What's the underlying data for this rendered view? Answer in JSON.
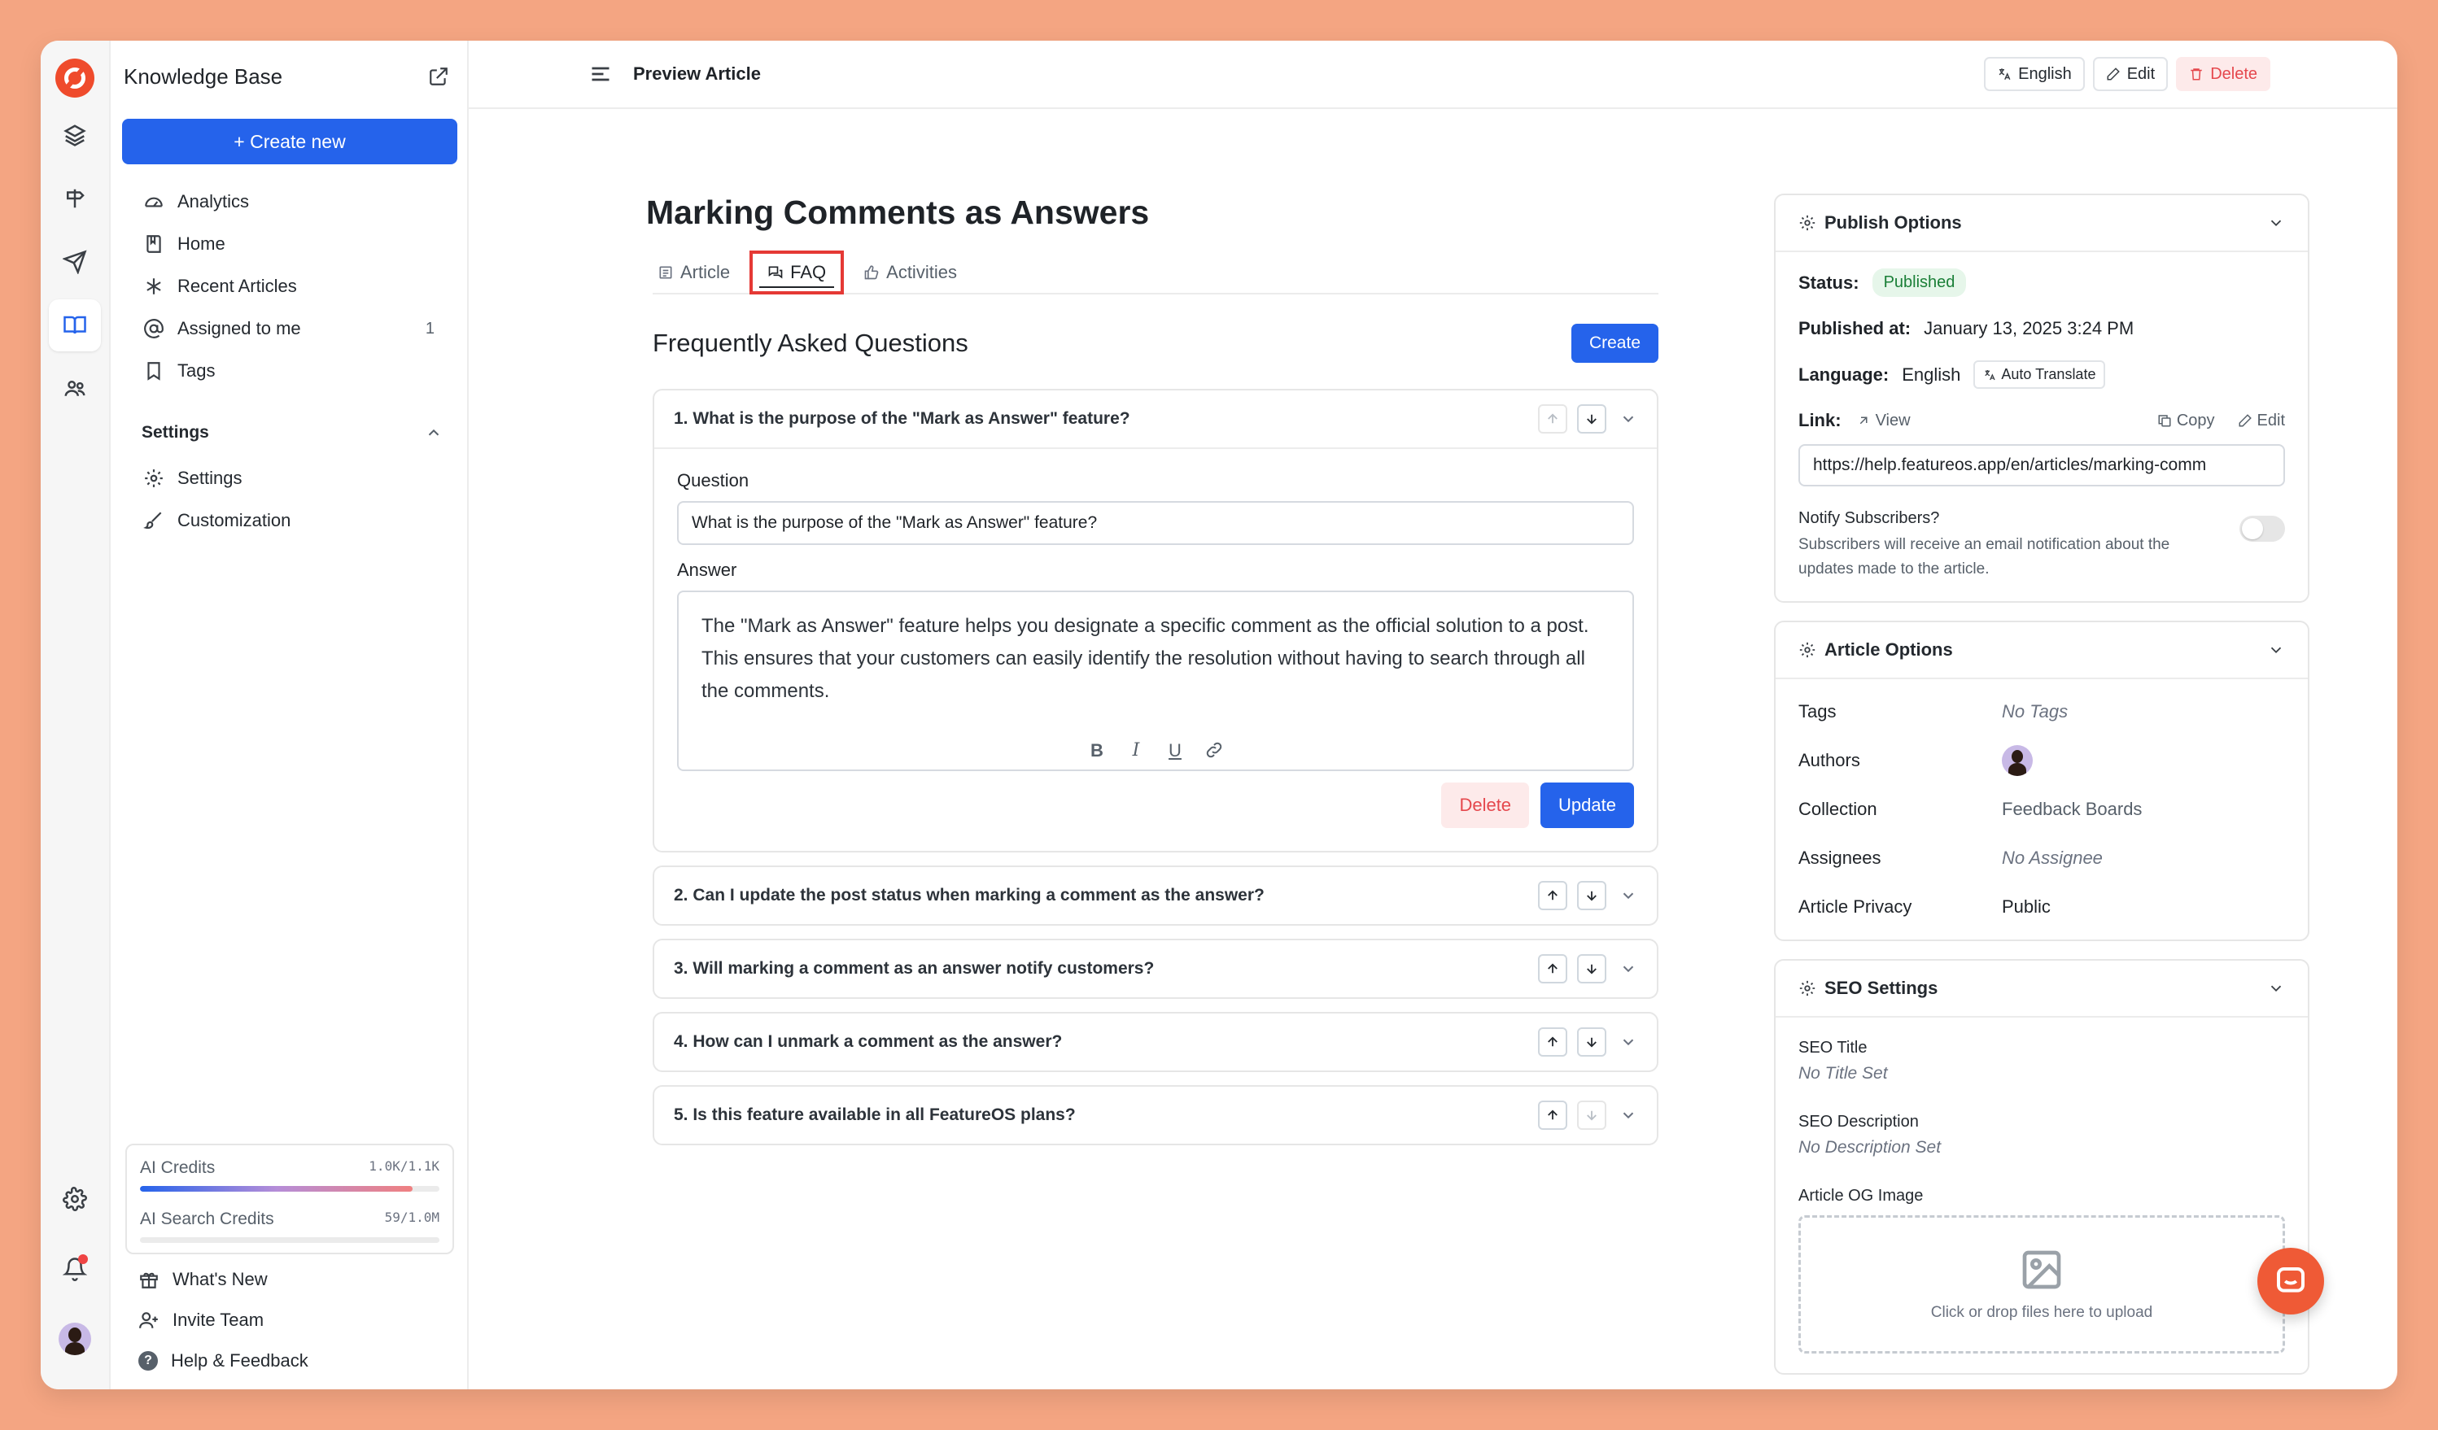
{
  "sidebar": {
    "title": "Knowledge Base",
    "create_label": "+ Create new",
    "nav": [
      {
        "label": "Analytics",
        "icon": "gauge-icon"
      },
      {
        "label": "Home",
        "icon": "book-icon"
      },
      {
        "label": "Recent Articles",
        "icon": "asterisk-icon"
      },
      {
        "label": "Assigned to me",
        "icon": "at-icon",
        "count": "1"
      },
      {
        "label": "Tags",
        "icon": "bookmark-icon"
      }
    ],
    "settings_section": "Settings",
    "settings_items": [
      {
        "label": "Settings",
        "icon": "gear-icon"
      },
      {
        "label": "Customization",
        "icon": "brush-icon"
      }
    ],
    "credits": {
      "ai_label": "AI Credits",
      "ai_value": "1.0K/1.1K",
      "ai_fraction": 0.91,
      "search_label": "AI Search Credits",
      "search_value": "59/1.0M",
      "search_fraction": 0.0
    },
    "footer": [
      {
        "label": "What's New",
        "icon": "gift-icon"
      },
      {
        "label": "Invite Team",
        "icon": "user-plus-icon"
      },
      {
        "label": "Help & Feedback",
        "icon": "help-icon"
      }
    ]
  },
  "topbar": {
    "title": "Preview Article",
    "language_btn": "English",
    "edit_btn": "Edit",
    "delete_btn": "Delete"
  },
  "article": {
    "title": "Marking Comments as Answers",
    "tabs": [
      "Article",
      "FAQ",
      "Activities"
    ],
    "active_tab": "FAQ"
  },
  "faq": {
    "heading": "Frequently Asked Questions",
    "create_label": "Create",
    "question_label": "Question",
    "answer_label": "Answer",
    "question_value": "What is the purpose of the \"Mark as Answer\" feature?",
    "answer_value": "The \"Mark as Answer\" feature helps you designate a specific comment as the official solution to a post. This ensures that your customers can easily identify the resolution without having to search through all the comments.",
    "delete_label": "Delete",
    "update_label": "Update",
    "items": [
      "1. What is the purpose of the \"Mark as Answer\" feature?",
      "2. Can I update the post status when marking a comment as the answer?",
      "3. Will marking a comment as an answer notify customers?",
      "4. How can I unmark a comment as the answer?",
      "5. Is this feature available in all FeatureOS plans?"
    ]
  },
  "publish": {
    "heading": "Publish Options",
    "status_label": "Status:",
    "status_value": "Published",
    "published_label": "Published at:",
    "published_value": "January 13, 2025 3:24 PM",
    "language_label": "Language:",
    "language_value": "English",
    "auto_translate": "Auto Translate",
    "link_label": "Link:",
    "view_label": "View",
    "copy_label": "Copy",
    "edit_label": "Edit",
    "url": "https://help.featureos.app/en/articles/marking-comm",
    "notify_title": "Notify Subscribers?",
    "notify_desc": "Subscribers will receive an email notification about the updates made to the article."
  },
  "article_options": {
    "heading": "Article Options",
    "rows": [
      {
        "k": "Tags",
        "v": "No Tags",
        "style": "italic"
      },
      {
        "k": "Authors",
        "v": "",
        "style": "avatar"
      },
      {
        "k": "Collection",
        "v": "Feedback Boards",
        "style": "muted"
      },
      {
        "k": "Assignees",
        "v": "No Assignee",
        "style": "italic"
      },
      {
        "k": "Article Privacy",
        "v": "Public",
        "style": "dark"
      }
    ]
  },
  "seo": {
    "heading": "SEO Settings",
    "title_label": "SEO Title",
    "title_value": "No Title Set",
    "desc_label": "SEO Description",
    "desc_value": "No Description Set",
    "og_label": "Article OG Image",
    "upload_hint": "Click or drop files here to upload"
  }
}
